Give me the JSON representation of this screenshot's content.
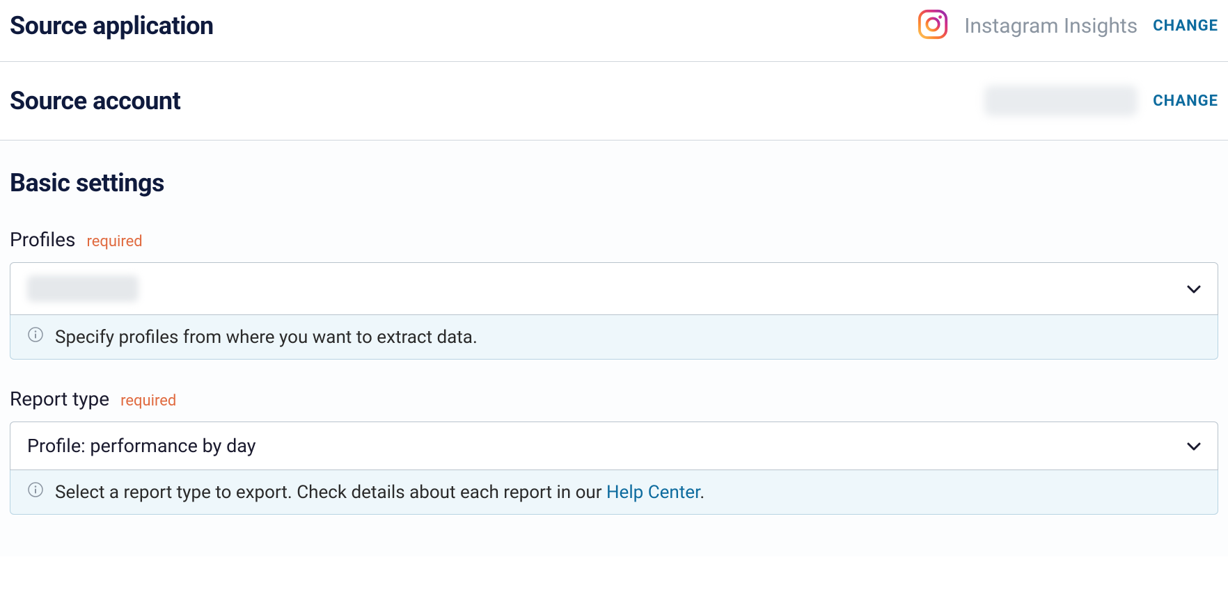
{
  "sourceApp": {
    "title": "Source application",
    "appName": "Instagram Insights",
    "changeLabel": "CHANGE"
  },
  "sourceAccount": {
    "title": "Source account",
    "changeLabel": "CHANGE"
  },
  "basicSettings": {
    "title": "Basic settings",
    "profiles": {
      "label": "Profiles",
      "requiredTag": "required",
      "hint": "Specify profiles from where you want to extract data."
    },
    "reportType": {
      "label": "Report type",
      "requiredTag": "required",
      "selectedValue": "Profile: performance by day",
      "hintPrefix": "Select a report type to export. Check details about each report in our ",
      "hintLink": "Help Center",
      "hintSuffix": "."
    }
  }
}
